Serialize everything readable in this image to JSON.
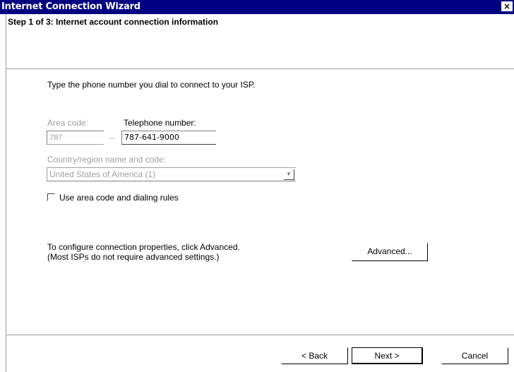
{
  "window": {
    "title": "Internet Connection Wizard",
    "close_glyph": "×"
  },
  "header": {
    "step_title": "Step 1 of 3: Internet account connection information"
  },
  "form": {
    "instruction": "Type the phone number you dial to connect to your ISP.",
    "area_code_label": "Area code:",
    "area_code_value": "787",
    "dash": "–",
    "telephone_label": "Telephone number:",
    "telephone_value": "787-641-9000",
    "country_label": "Country/region name and code:",
    "country_value": "United States of America (1)",
    "dropdown_glyph": "▼",
    "dialing_rules_label": "Use area code and dialing rules",
    "dialing_rules_checked": false
  },
  "advanced": {
    "line1": "To configure connection properties, click Advanced.",
    "line2": "(Most ISPs do not require advanced settings.)",
    "button_label": "Advanced..."
  },
  "buttons": {
    "back": "< Back",
    "next": "Next >",
    "cancel": "Cancel"
  }
}
